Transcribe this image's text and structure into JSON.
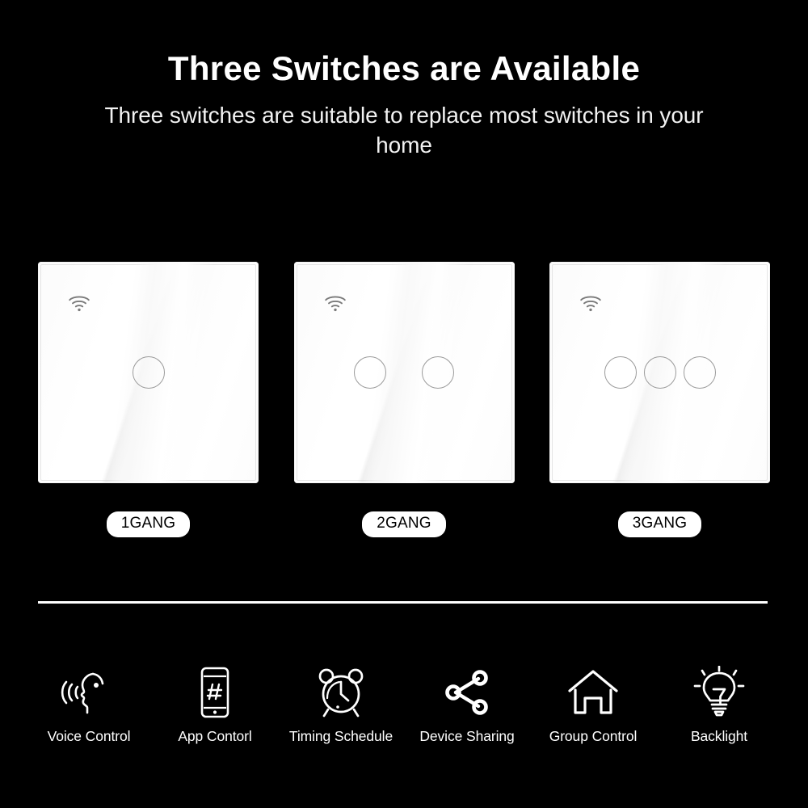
{
  "header": {
    "title": "Three Switches are Available",
    "subtitle": "Three switches are suitable to replace most switches in your home"
  },
  "theme": {
    "background": "#000000",
    "text": "#ffffff",
    "panel_white": "#ffffff",
    "button_outline": "#9a9a9a",
    "wifi_icon_color": "#7a7a7a"
  },
  "products": [
    {
      "label": "1GANG",
      "gangs": 1,
      "status_icon": "wifi-icon",
      "button_count": 1
    },
    {
      "label": "2GANG",
      "gangs": 2,
      "status_icon": "wifi-icon",
      "button_count": 2
    },
    {
      "label": "3GANG",
      "gangs": 3,
      "status_icon": "wifi-icon",
      "button_count": 3
    }
  ],
  "features": [
    {
      "label": "Voice Control",
      "icon": "voice-control-icon"
    },
    {
      "label": "App Contorl",
      "icon": "smartphone-app-icon"
    },
    {
      "label": "Timing Schedule",
      "icon": "alarm-clock-icon"
    },
    {
      "label": "Device Sharing",
      "icon": "share-nodes-icon"
    },
    {
      "label": "Group Control",
      "icon": "home-house-icon"
    },
    {
      "label": "Backlight",
      "icon": "light-bulb-icon"
    }
  ]
}
